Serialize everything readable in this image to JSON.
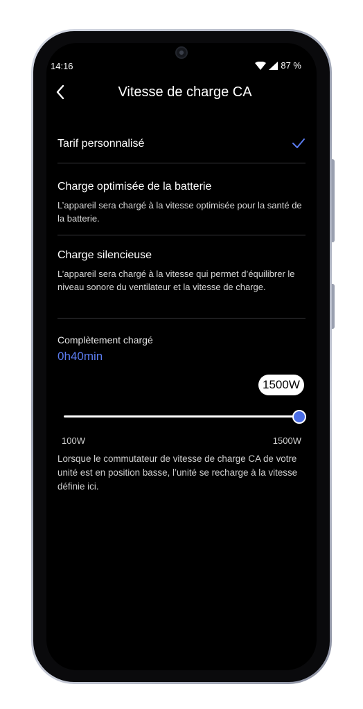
{
  "status_bar": {
    "time": "14:16",
    "battery": "87 %"
  },
  "header": {
    "title": "Vitesse de charge CA"
  },
  "options": [
    {
      "title": "Tarif personnalisé",
      "selected": true
    },
    {
      "title": "Charge optimisée de la batterie",
      "description": "L’appareil sera chargé à la vitesse optimisée pour la santé de la batterie."
    },
    {
      "title": "Charge silencieuse",
      "description": "L’appareil sera chargé à la vitesse qui permet d’équilibrer le niveau sonore du ventilateur et la vitesse de charge."
    }
  ],
  "charge": {
    "label": "Complètement chargé",
    "time": "0h40min"
  },
  "slider": {
    "current": "1500W",
    "min_label": "100W",
    "max_label": "1500W",
    "level_fraction": 1.0
  },
  "note": "Lorsque le commutateur de vitesse de charge CA de votre unité est en position basse, l’unité se recharge à la vitesse définie ici.",
  "colors": {
    "accent": "#5b7cf0",
    "background": "#000000"
  }
}
